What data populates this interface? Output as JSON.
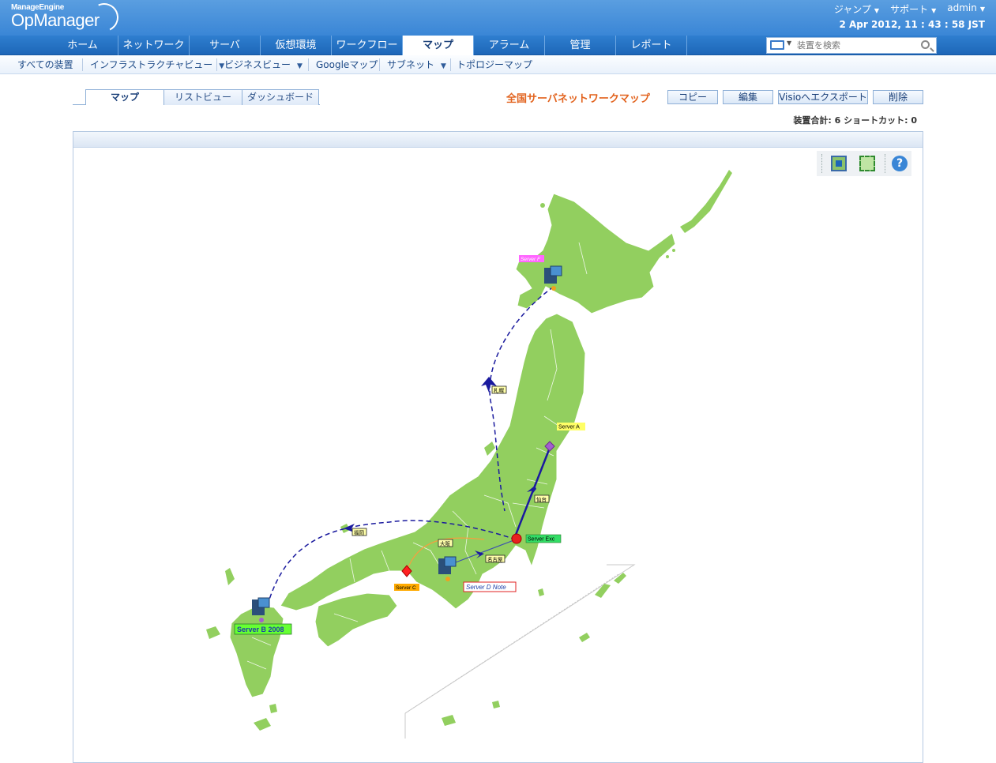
{
  "app": {
    "brand": "ManageEngine",
    "product": "OpManager"
  },
  "topmenu": {
    "jump": "ジャンプ",
    "support": "サポート",
    "user": "admin"
  },
  "datetime": "2 Apr 2012, 11 : 43 : 58 JST",
  "nav": {
    "tabs": [
      "ホーム",
      "ネットワーク",
      "サーバ",
      "仮想環境",
      "ワークフロー",
      "マップ",
      "アラーム",
      "管理",
      "レポート"
    ],
    "active": "マップ",
    "search_placeholder": "装置を検索"
  },
  "subnav": [
    "すべての装置",
    "インフラストラクチャビュー",
    "ビジネスビュー",
    "Googleマップ",
    "サブネット",
    "トポロジーマップ"
  ],
  "view_tabs": [
    "マップ",
    "リストビュー",
    "ダッシュボード"
  ],
  "map_title": "全国サーバネットワークマップ",
  "actions": [
    "コピー",
    "編集",
    "Visioへエクスポート",
    "削除"
  ],
  "counts": "装置合計: 6  ショートカット: 0",
  "toolbar": {
    "fit_icon": "fit-to-screen-icon",
    "expand_icon": "expand-icon",
    "help_icon": "help-icon",
    "help_glyph": "?"
  },
  "map": {
    "land_color": "#92cf5f",
    "devices": [
      {
        "label": "Server F",
        "label_bg": "#ff66ff",
        "label_color": "#ffffff",
        "icon": "server-icon"
      },
      {
        "label": "Server A",
        "label_bg": "#ffff66",
        "label_color": "#000000",
        "icon": "diamond-icon"
      },
      {
        "label": "Server Exc",
        "label_bg": "#33dd66",
        "label_color": "#000000",
        "icon": "red-dot-icon"
      },
      {
        "label": "Server C",
        "label_bg": "#ffaa00",
        "label_color": "#000000",
        "icon": "red-diamond-icon"
      },
      {
        "label": "Server D Note",
        "label_bg": "#ffffff",
        "label_color": "#1d3fa8",
        "icon": "server-icon"
      },
      {
        "label": "Server B 2008",
        "label_bg": "#66ff33",
        "label_color": "#1d3fa8",
        "icon": "server-icon"
      }
    ],
    "link_labels": [
      "札幌",
      "仙台",
      "名古屋",
      "福岡",
      "大阪"
    ]
  }
}
